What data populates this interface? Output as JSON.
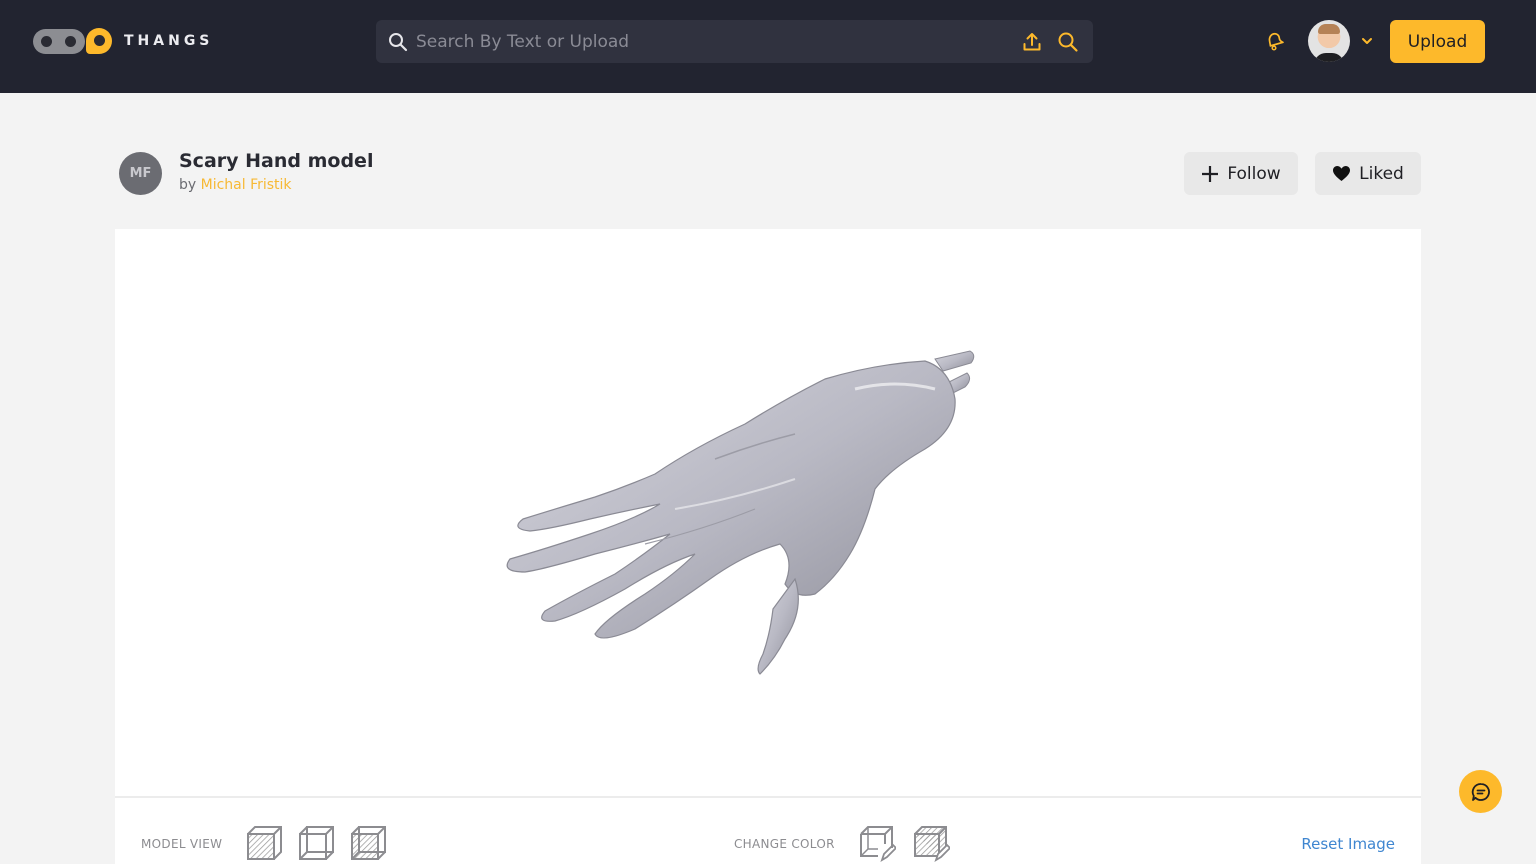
{
  "header": {
    "logo_text": "THANGS",
    "search": {
      "placeholder": "Search By Text or Upload",
      "value": "",
      "lead_icon": "search-icon",
      "upload_icon": "upload-icon",
      "submit_icon": "search-icon"
    },
    "notifications_icon": "bell-icon",
    "avatar_icon": "user-avatar",
    "menu_icon": "chevron-down-icon",
    "upload_label": "Upload"
  },
  "model": {
    "author_initials": "MF",
    "title": "Scary Hand model",
    "by_prefix": "by",
    "author_name": "Michal Fristik",
    "follow_label": "Follow",
    "liked_label": "Liked"
  },
  "viewer": {
    "model_view_label": "MODEL VIEW",
    "model_view_options": [
      "shaded-view",
      "wireframe-view",
      "xray-view"
    ],
    "change_color_label": "CHANGE COLOR",
    "color_options": [
      "wireframe-color",
      "shaded-color"
    ],
    "reset_label": "Reset Image"
  },
  "colors": {
    "accent": "#fdb92b",
    "topbar": "#222430",
    "link": "#3f86d0"
  }
}
